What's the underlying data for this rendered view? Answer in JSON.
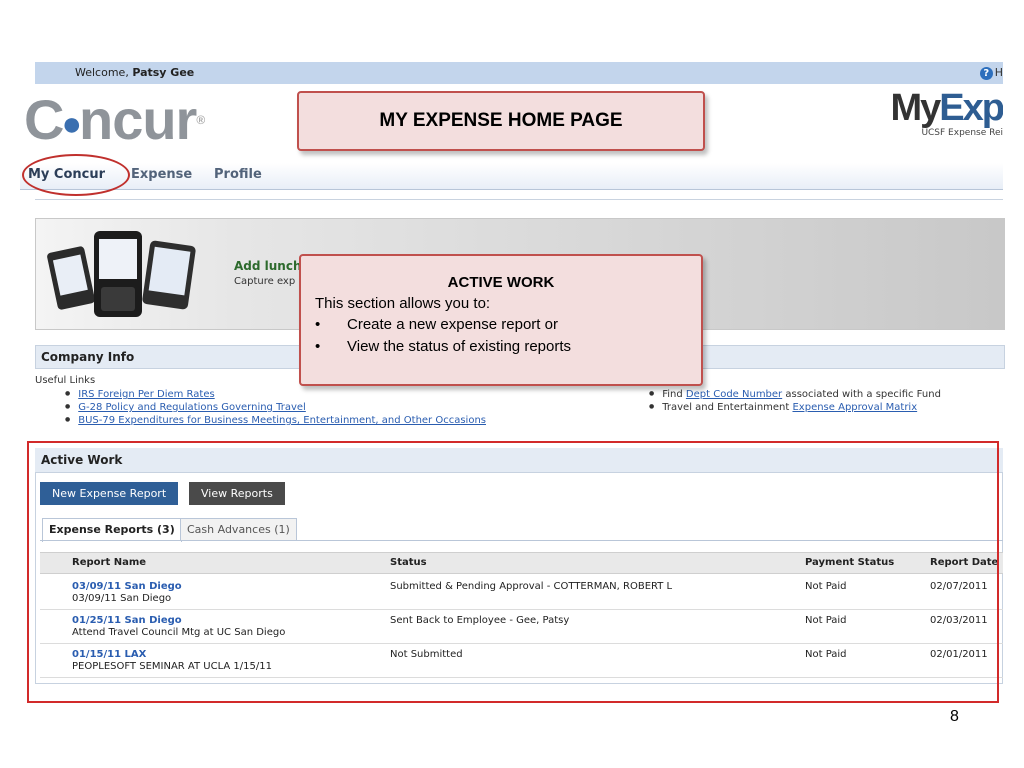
{
  "topbar": {
    "welcome_prefix": "Welcome, ",
    "user_name": "Patsy Gee",
    "help_label": "H"
  },
  "logo": {
    "text_c": "C",
    "text_ncur": "ncur",
    "registered": "®"
  },
  "brand_right": {
    "title_my": "My",
    "title_exp": "Exp",
    "subtitle": "UCSF Expense Rei"
  },
  "callouts": {
    "home_title": "MY EXPENSE HOME PAGE",
    "active_title": "ACTIVE WORK",
    "active_intro": "This section allows you to:",
    "active_bullets": [
      "Create a new expense report or",
      "View the status of existing reports"
    ]
  },
  "nav": {
    "tabs": [
      "My Concur",
      "Expense",
      "Profile"
    ]
  },
  "banner": {
    "title": "Add lunch",
    "subtitle": "Capture exp"
  },
  "company_info": {
    "header": "Company Info",
    "useful_links_label": "Useful Links",
    "left_links": [
      "IRS Foreign Per Diem Rates",
      "G-28 Policy and Regulations Governing Travel",
      "BUS-79 Expenditures for Business Meetings, Entertainment, and Other Occasions"
    ],
    "right_items": [
      {
        "prefix": "Find ",
        "link": "Dept Code Number",
        "suffix": " associated with a specific Fund"
      },
      {
        "prefix": "Travel and Entertainment ",
        "link": "Expense Approval Matrix",
        "suffix": ""
      }
    ]
  },
  "active_work": {
    "header": "Active Work",
    "new_button": "New Expense Report",
    "view_button": "View Reports",
    "tabs": [
      "Expense Reports (3)",
      "Cash Advances (1)"
    ],
    "columns": [
      "Report Name",
      "Status",
      "Payment Status",
      "Report Date"
    ],
    "rows": [
      {
        "name": "03/09/11 San Diego",
        "desc": "03/09/11 San Diego",
        "status": "Submitted & Pending Approval - COTTERMAN, ROBERT L",
        "payment": "Not Paid",
        "date": "02/07/2011"
      },
      {
        "name": "01/25/11 San Diego",
        "desc": "Attend Travel Council Mtg at UC San Diego",
        "status": "Sent Back to Employee - Gee, Patsy",
        "payment": "Not Paid",
        "date": "02/03/2011"
      },
      {
        "name": "01/15/11 LAX",
        "desc": "PEOPLESOFT SEMINAR AT UCLA 1/15/11",
        "status": "Not Submitted",
        "payment": "Not Paid",
        "date": "02/01/2011"
      }
    ]
  },
  "slide_number": "8",
  "colors": {
    "accent_blue": "#2f5f97",
    "callout_border": "#c0504d",
    "highlight_red": "#d22a2a"
  }
}
